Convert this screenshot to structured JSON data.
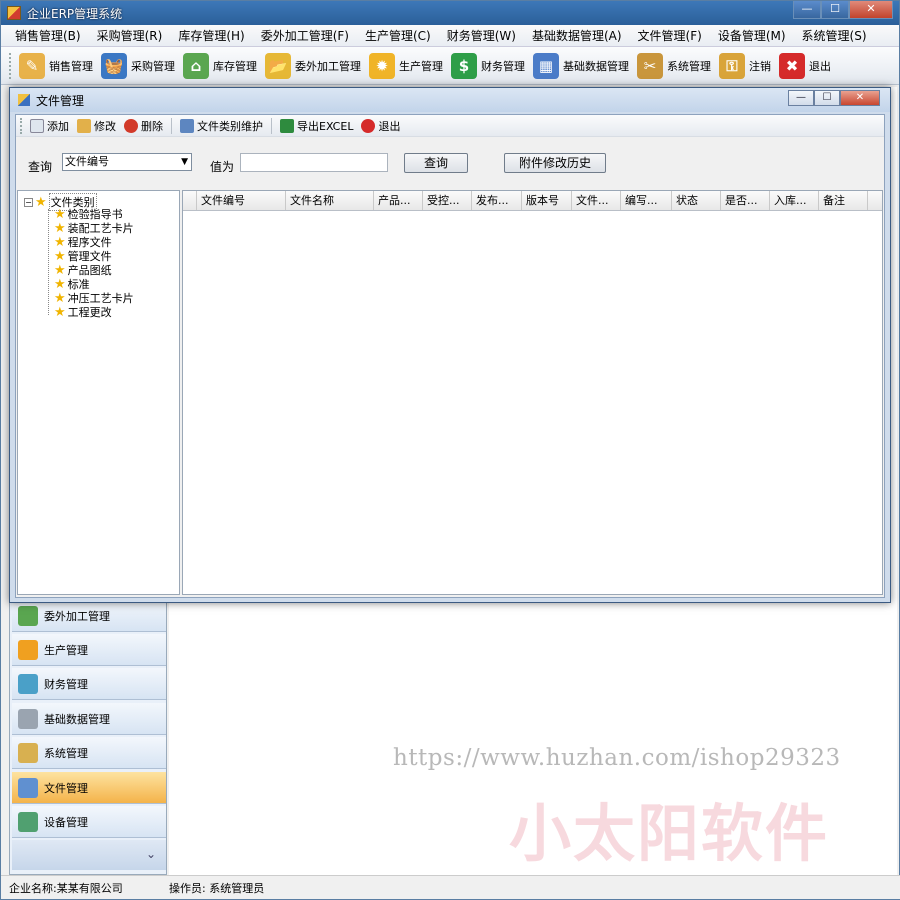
{
  "window": {
    "title": "企业ERP管理系统",
    "btn_min": "—",
    "btn_max": "☐",
    "btn_close": "✕"
  },
  "menu": [
    "销售管理(B)",
    "采购管理(R)",
    "库存管理(H)",
    "委外加工管理(F)",
    "生产管理(C)",
    "财务管理(W)",
    "基础数据管理(A)",
    "文件管理(F)",
    "设备管理(M)",
    "系统管理(S)"
  ],
  "toolbar": [
    {
      "label": "销售管理",
      "icon": "pencil-icon",
      "color": "#e8b24a"
    },
    {
      "label": "采购管理",
      "icon": "basket-icon",
      "color": "#3b78c4"
    },
    {
      "label": "库存管理",
      "icon": "house-icon",
      "color": "#5aa650"
    },
    {
      "label": "委外加工管理",
      "icon": "folder-icon",
      "color": "#e6b836"
    },
    {
      "label": "生产管理",
      "icon": "gear-icon",
      "color": "#f0b428"
    },
    {
      "label": "财务管理",
      "icon": "dollar-icon",
      "color": "#2e9e48"
    },
    {
      "label": "基础数据管理",
      "icon": "table-icon",
      "color": "#4b7cc8"
    },
    {
      "label": "系统管理",
      "icon": "tools-icon",
      "color": "#c9963c"
    },
    {
      "label": "注销",
      "icon": "key-icon",
      "color": "#d9a43a"
    },
    {
      "label": "退出",
      "icon": "exit-icon",
      "color": "#d52a2a"
    }
  ],
  "toolbar_glyphs": [
    "✎",
    "🧺",
    "⌂",
    "📂",
    "✹",
    "$",
    "▦",
    "✂",
    "⚿",
    "✖"
  ],
  "sidebar": {
    "items": [
      {
        "label": "委外加工管理",
        "color": "#5aa650"
      },
      {
        "label": "生产管理",
        "color": "#f0a020"
      },
      {
        "label": "财务管理",
        "color": "#4aa0c8"
      },
      {
        "label": "基础数据管理",
        "color": "#9aa4b0"
      },
      {
        "label": "系统管理",
        "color": "#d8b050"
      },
      {
        "label": "文件管理",
        "color": "#6090d0"
      },
      {
        "label": "设备管理",
        "color": "#50a070"
      }
    ],
    "active": "文件管理",
    "chevron": "⌄"
  },
  "status": {
    "company": "企业名称:某某有限公司",
    "operator": "操作员: 系统管理员"
  },
  "watermark": {
    "url": "https://www.huzhan.com/ishop29323",
    "brand": "小太阳软件"
  },
  "child": {
    "title": "文件管理",
    "toolbar": [
      {
        "label": "添加",
        "icon": "new-doc-icon",
        "color": "#dfe6ee"
      },
      {
        "label": "修改",
        "icon": "edit-icon",
        "color": "#e2b04a"
      },
      {
        "label": "删除",
        "icon": "delete-icon",
        "color": "#d23a2a"
      },
      {
        "label": "文件类别维护",
        "icon": "category-icon",
        "color": "#5d86c0"
      },
      {
        "label": "导出EXCEL",
        "icon": "excel-icon",
        "color": "#2e8b3e"
      },
      {
        "label": "退出",
        "icon": "exit-icon",
        "color": "#d52a2a"
      }
    ],
    "query": {
      "label": "查询",
      "field": "文件编号",
      "value_label": "值为",
      "value": "",
      "query_button": "查询",
      "history_button": "附件修改历史"
    },
    "tree": {
      "root": "文件类别",
      "items": [
        "检验指导书",
        "装配工艺卡片",
        "程序文件",
        "管理文件",
        "产品图纸",
        "标准",
        "冲压工艺卡片",
        "工程更改"
      ]
    },
    "grid": {
      "columns": [
        "文件编号",
        "文件名称",
        "产品...",
        "受控...",
        "发布...",
        "版本号",
        "文件...",
        "编写...",
        "状态",
        "是否...",
        "入库...",
        "备注"
      ]
    }
  }
}
